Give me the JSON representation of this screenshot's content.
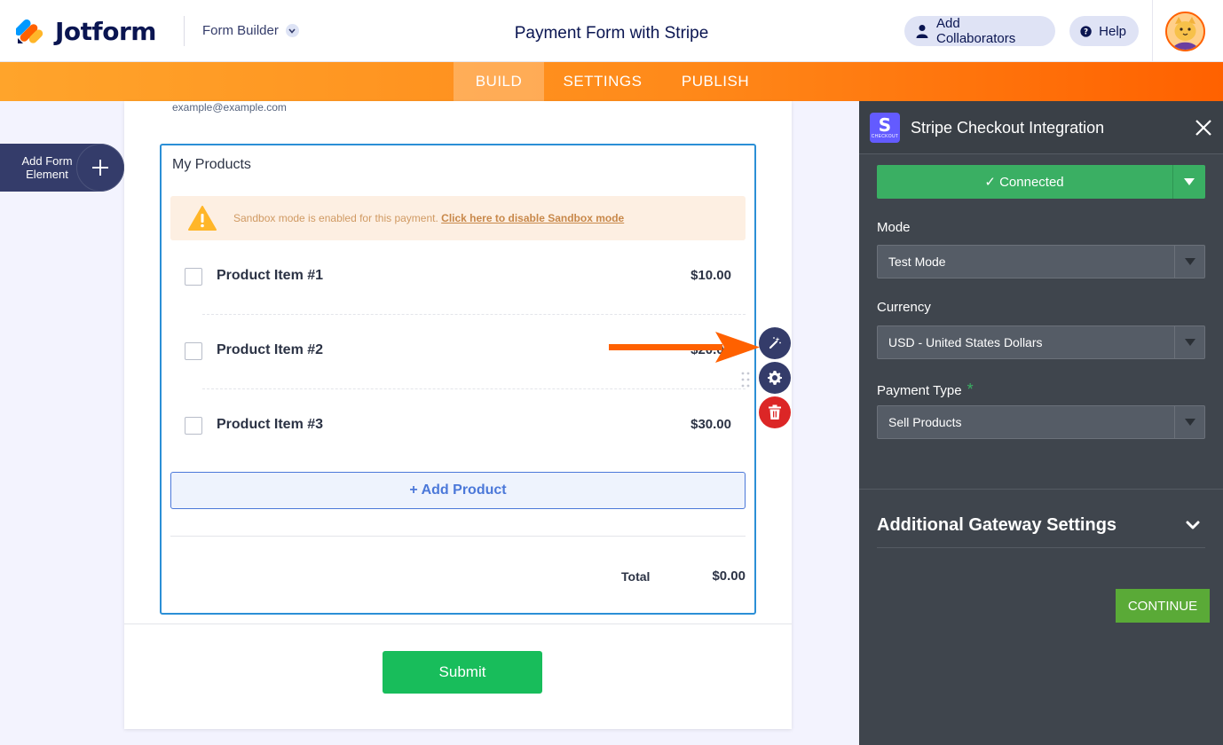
{
  "header": {
    "brand": "Jotform",
    "form_builder": "Form Builder",
    "title": "Payment Form with Stripe",
    "add_collaborators": "Add Collaborators",
    "help": "Help"
  },
  "nav": {
    "tabs": [
      {
        "label": "BUILD",
        "active": true
      },
      {
        "label": "SETTINGS",
        "active": false
      },
      {
        "label": "PUBLISH",
        "active": false
      }
    ]
  },
  "sidebar": {
    "add_element_line1": "Add Form",
    "add_element_line2": "Element"
  },
  "form": {
    "email_hint": "example@example.com",
    "field_label": "My Products",
    "sandbox_text": "Sandbox mode is enabled for this payment.",
    "sandbox_link": "Click here to disable Sandbox mode",
    "products": [
      {
        "name": "Product Item #1",
        "price": "$10.00"
      },
      {
        "name": "Product Item #2",
        "price": "$20.00"
      },
      {
        "name": "Product Item #3",
        "price": "$30.00"
      }
    ],
    "add_product": "+ Add Product",
    "total_label": "Total",
    "total_value": "$0.00",
    "submit": "Submit"
  },
  "panel": {
    "title": "Stripe Checkout Integration",
    "logo_letter": "S",
    "logo_sub": "CHECKOUT",
    "connected": "✓ Connected",
    "mode_label": "Mode",
    "mode_value": "Test Mode",
    "currency_label": "Currency",
    "currency_value": "USD - United States Dollars",
    "payment_type_label": "Payment Type",
    "payment_type_required": "*",
    "payment_type_value": "Sell Products",
    "additional_settings": "Additional Gateway Settings",
    "continue": "CONTINUE"
  },
  "colors": {
    "accent_orange": "#ff6100",
    "navy": "#0a1551",
    "connected_green": "#3aaf63",
    "submit_green": "#18bd5b",
    "field_border_blue": "#2b8fd6",
    "delete_red": "#dc2626",
    "stripe_purple": "#635bff"
  },
  "icons": [
    "jotform-logo-icon",
    "chevron-down-icon",
    "user-icon",
    "question-icon",
    "avatar-icon",
    "plus-icon",
    "warning-icon",
    "wand-icon",
    "gear-icon",
    "trash-icon",
    "drag-handle-icon",
    "arrow-annotation-icon",
    "stripe-logo-icon",
    "close-icon",
    "caret-down-icon"
  ]
}
